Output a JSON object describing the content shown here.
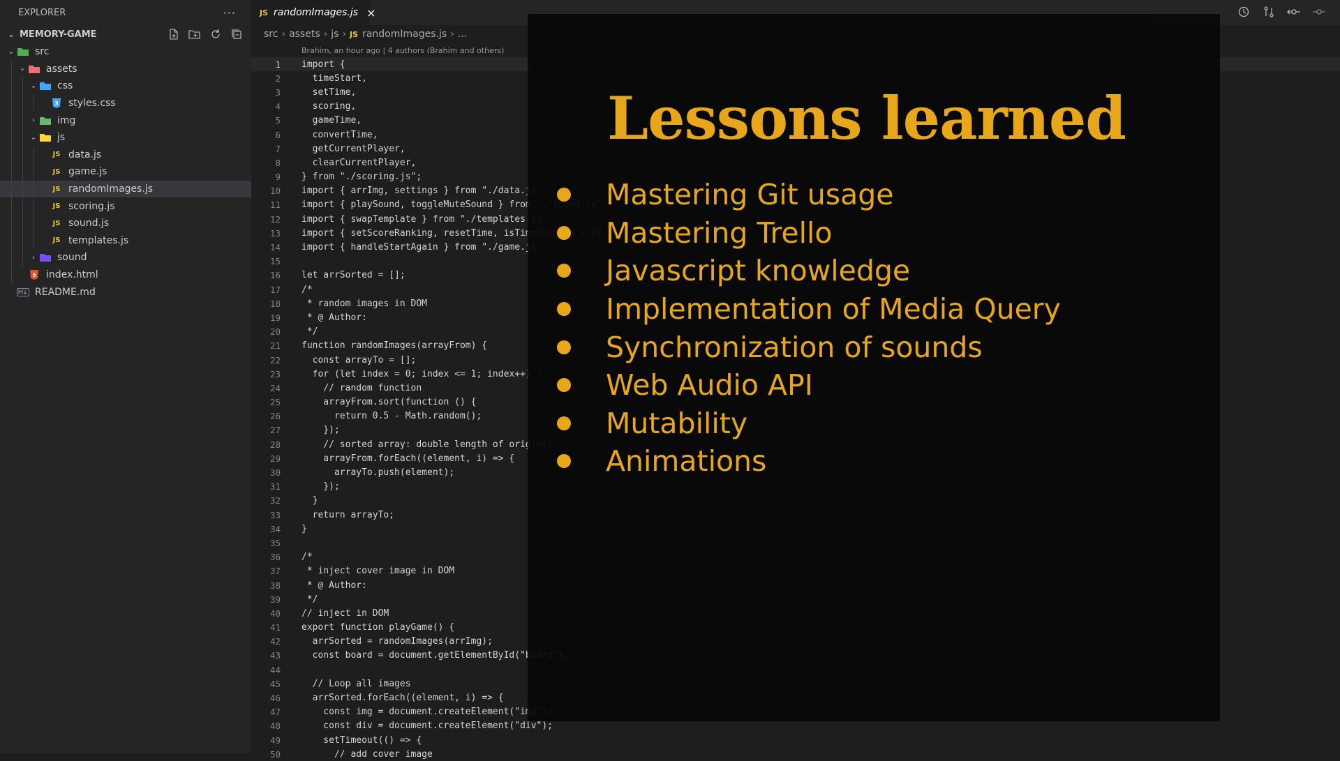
{
  "sidebar": {
    "title": "EXPLORER",
    "more": "···",
    "project": "MEMORY-GAME",
    "tree": [
      {
        "label": "src",
        "type": "folder",
        "depth": 0,
        "open": true,
        "color": "#4caf50"
      },
      {
        "label": "assets",
        "type": "folder",
        "depth": 1,
        "open": true,
        "color": "#e57373"
      },
      {
        "label": "css",
        "type": "folder",
        "depth": 2,
        "open": true,
        "color": "#42a5f5"
      },
      {
        "label": "styles.css",
        "type": "css",
        "depth": 3
      },
      {
        "label": "img",
        "type": "folder",
        "depth": 2,
        "open": false,
        "color": "#66bb6a"
      },
      {
        "label": "js",
        "type": "folder",
        "depth": 2,
        "open": true,
        "color": "#fdd835"
      },
      {
        "label": "data.js",
        "type": "js",
        "depth": 3
      },
      {
        "label": "game.js",
        "type": "js",
        "depth": 3
      },
      {
        "label": "randomImages.js",
        "type": "js",
        "depth": 3,
        "selected": true
      },
      {
        "label": "scoring.js",
        "type": "js",
        "depth": 3
      },
      {
        "label": "sound.js",
        "type": "js",
        "depth": 3
      },
      {
        "label": "templates.js",
        "type": "js",
        "depth": 3
      },
      {
        "label": "sound",
        "type": "folder",
        "depth": 2,
        "open": false,
        "color": "#7c4dff"
      },
      {
        "label": "index.html",
        "type": "html",
        "depth": 1
      },
      {
        "label": "README.md",
        "type": "md",
        "depth": 0
      }
    ]
  },
  "editor": {
    "tab": {
      "badge": "JS",
      "label": "randomImages.js",
      "close": "×"
    },
    "breadcrumb": [
      "src",
      "assets",
      "js"
    ],
    "breadcrumb_file": "randomImages.js",
    "breadcrumb_tail": "...",
    "blame": "Brahim, an hour ago | 4 authors (Brahim and others)",
    "lines": [
      "import {",
      "  timeStart,",
      "  setTime,",
      "  scoring,",
      "  gameTime,",
      "  convertTime,",
      "  getCurrentPlayer,",
      "  clearCurrentPlayer,",
      "} from \"./scoring.js\";",
      "import { arrImg, settings } from \"./data.js\";",
      "import { playSound, toggleMuteSound } from \"./sound.js\";",
      "import { swapTemplate } from \"./templates.js\";",
      "import { setScoreRanking, resetTime, isTimeRunning } fr",
      "import { handleStartAgain } from \"./game.js\";",
      "",
      "let arrSorted = [];",
      "/*",
      " * random images in DOM",
      " * @ Author:",
      " */",
      "function randomImages(arrayFrom) {",
      "  const arrayTo = [];",
      "  for (let index = 0; index <= 1; index++) {",
      "    // random function",
      "    arrayFrom.sort(function () {",
      "      return 0.5 - Math.random();",
      "    });",
      "    // sorted array: double length of original",
      "    arrayFrom.forEach((element, i) => {",
      "      arrayTo.push(element);",
      "    });",
      "  }",
      "  return arrayTo;",
      "}",
      "",
      "/*",
      " * inject cover image in DOM",
      " * @ Author:",
      " */",
      "// inject in DOM",
      "export function playGame() {",
      "  arrSorted = randomImages(arrImg);",
      "  const board = document.getElementById(\"board\");",
      "",
      "  // Loop all images",
      "  arrSorted.forEach((element, i) => {",
      "    const img = document.createElement(\"img\");",
      "    const div = document.createElement(\"div\");",
      "    setTimeout(() => {",
      "      // add cover image"
    ]
  },
  "slide": {
    "title": "Lessons learned",
    "bullets": [
      "Mastering Git usage",
      "Mastering Trello",
      "Javascript knowledge",
      "Implementation of Media Query",
      "Synchronization of sounds",
      "Web Audio API",
      "Mutability",
      "Animations"
    ]
  }
}
